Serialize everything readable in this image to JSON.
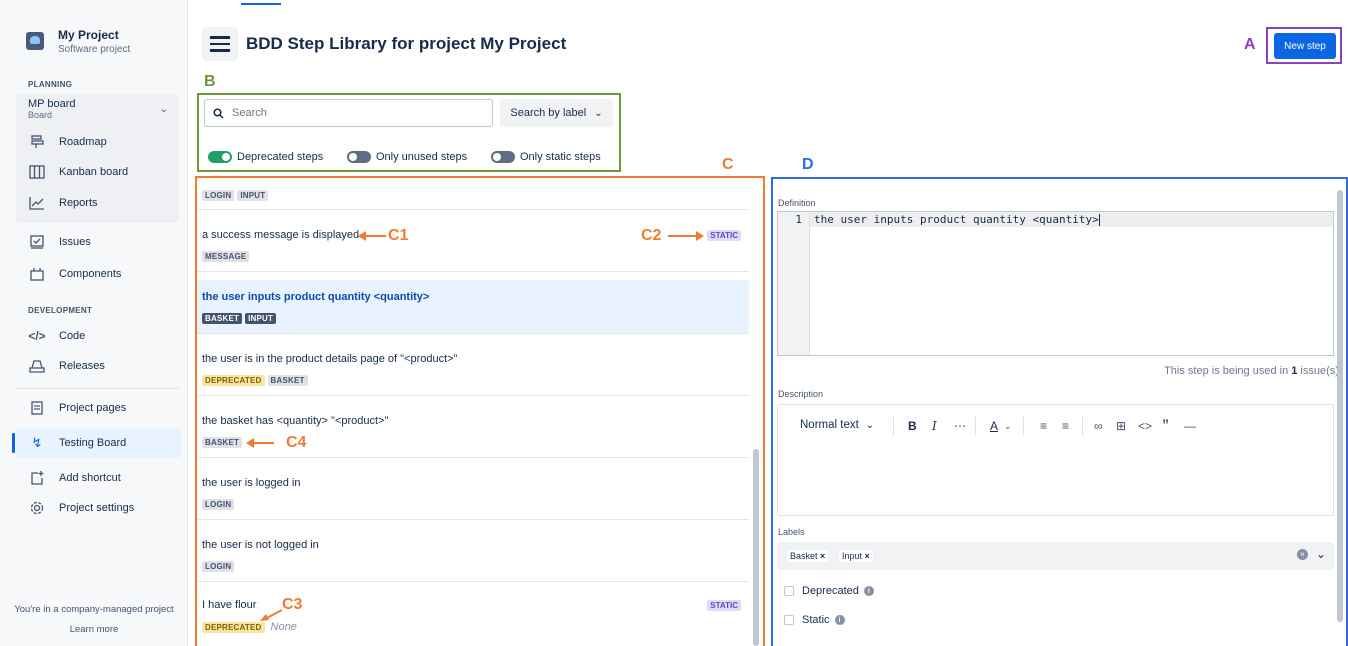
{
  "sidebar": {
    "project_name": "My Project",
    "project_type": "Software project",
    "planning_title": "PLANNING",
    "board_name": "MP board",
    "board_sub": "Board",
    "items_planning": [
      "Roadmap",
      "Kanban board",
      "Reports"
    ],
    "issues": "Issues",
    "components": "Components",
    "development_title": "DEVELOPMENT",
    "code": "Code",
    "releases": "Releases",
    "project_pages": "Project pages",
    "testing_board": "Testing Board",
    "add_shortcut": "Add shortcut",
    "project_settings": "Project settings",
    "footer_text": "You're in a company-managed project",
    "footer_link": "Learn more"
  },
  "header": {
    "title": "BDD Step Library for project My Project",
    "new_step": "New step"
  },
  "filters": {
    "search_placeholder": "Search",
    "search_by": "Search by label",
    "toggles": [
      {
        "label": "Deprecated steps",
        "on": true
      },
      {
        "label": "Only unused steps",
        "on": false
      },
      {
        "label": "Only static steps",
        "on": false
      }
    ]
  },
  "steps": [
    {
      "text": "",
      "labels": [
        "LOGIN",
        "INPUT"
      ]
    },
    {
      "text": "a success message is displayed",
      "labels": [
        "MESSAGE"
      ],
      "static": "STATIC"
    },
    {
      "text": "the user inputs product quantity <quantity>",
      "labels": [
        "BASKET",
        "INPUT"
      ],
      "selected": true
    },
    {
      "text": "the user is in the product details page of \"<product>\"",
      "labels": [
        "DEPRECATED",
        "BASKET"
      ]
    },
    {
      "text": "the basket has <quantity> \"<product>\"",
      "labels": [
        "BASKET"
      ]
    },
    {
      "text": "the user is logged in",
      "labels": [
        "LOGIN"
      ]
    },
    {
      "text": "the user is not logged in",
      "labels": [
        "LOGIN"
      ]
    },
    {
      "text": "I have flour",
      "labels": [
        "DEPRECATED"
      ],
      "none": "None",
      "static": "STATIC"
    }
  ],
  "detail": {
    "definition_label": "Definition",
    "line_number": "1",
    "code": "the user inputs product quantity <quantity>",
    "usage_prefix": "This step is being used in ",
    "usage_count": "1",
    "usage_suffix": " issue(s).",
    "description_label": "Description",
    "text_style": "Normal text",
    "labels_label": "Labels",
    "chips": [
      "Basket",
      "Input"
    ],
    "deprecated": "Deprecated",
    "static": "Static"
  },
  "annotations": {
    "A": "A",
    "B": "B",
    "C": "C",
    "D": "D",
    "C1": "C1",
    "C2": "C2",
    "C3": "C3",
    "C4": "C4"
  },
  "colors": {
    "primary": "#0c66e4",
    "annotation_purple": "#8f3fc2",
    "annotation_green": "#6a9a3a",
    "annotation_orange": "#f07c33",
    "annotation_blue": "#2b6de8"
  }
}
